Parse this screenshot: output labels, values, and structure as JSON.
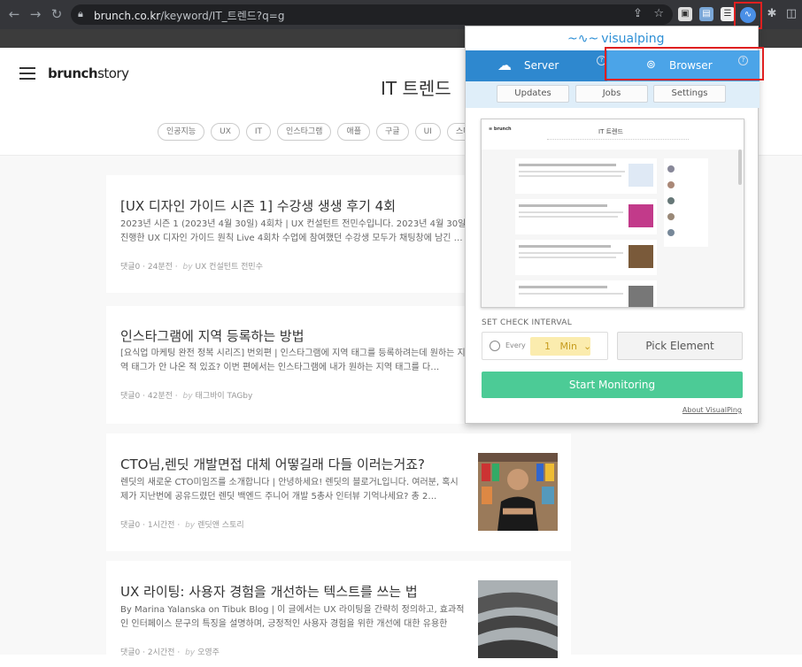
{
  "browser": {
    "url_host": "brunch.co.kr",
    "url_path": "/keyword/IT_트렌드?q=g"
  },
  "site": {
    "logo_main": "brunch",
    "logo_sub": "story",
    "page_title": "IT 트렌드",
    "tags": [
      "인공지능",
      "UX",
      "IT",
      "인스타그램",
      "애플",
      "구글",
      "UI",
      "스마트폰"
    ]
  },
  "articles": [
    {
      "title": "[UX 디자인 가이드 시즌 1] 수강생 생생 후기 4회",
      "desc": "2023년 시즌 1 (2023년 4월 30일) 4회차 | UX 컨설턴트 전민수입니다. 2023년 4월 30일 진행한 UX 디자인 가이드 원칙 Live 4회차 수업에 참여했던 수강생 모두가 채팅창에 남긴 …",
      "comments": "댓글0",
      "time": "24분전",
      "by": "by",
      "author": "UX 컨설턴트 전민수"
    },
    {
      "title": "인스타그램에 지역 등록하는 방법",
      "desc": "[요식업 마케팅 완전 정복 시리즈] 번외편 | 인스타그램에 지역 태그를 등록하려는데 원하는 지역 태그가 안 나온 적 있죠? 이번 편에서는 인스타그램에 내가 원하는 지역 태그를 다…",
      "comments": "댓글0",
      "time": "42분전",
      "by": "by",
      "author": "태그바이 TAGby"
    },
    {
      "title": "CTO님,렌딧 개발면접 대체 어떻길래 다들 이러는거죠?",
      "desc": "렌딧의 새로운 CTO미임즈를 소개합니다 | 안녕하세요! 렌딧의 블로거L입니다. 여러분, 혹시 제가 지난번에 공유드렸던 렌딧 백엔드 주니어 개발 5총사 인터뷰 기억나세요? 총 2…",
      "comments": "댓글0",
      "time": "1시간전",
      "by": "by",
      "author": "렌딧앤 스토리"
    },
    {
      "title": "UX 라이팅: 사용자 경험을 개선하는 텍스트를 쓰는 법",
      "desc": "By Marina Yalanska on Tibuk Blog | 이 글에서는 UX 라이팅을 간략히 정의하고, 효과적인 인터페이스 문구의 특징을 설명하며, 긍정적인 사용자 경험을 위한 개선에 대한 유용한 팁…",
      "comments": "댓글0",
      "time": "2시간전",
      "by": "by",
      "author": "오영주"
    }
  ],
  "visualping": {
    "brand": "visualping",
    "tab_server": "Server",
    "tab_browser": "Browser",
    "help": "?",
    "sub_updates": "Updates",
    "sub_jobs": "Jobs",
    "sub_settings": "Settings",
    "preview_title": "IT 트렌드",
    "interval_label": "SET CHECK INTERVAL",
    "every": "Every",
    "interval_value": "1",
    "interval_unit": "Min",
    "pick_element": "Pick Element",
    "start_monitoring": "Start Monitoring",
    "about": "About VisualPing"
  },
  "colors": {
    "vp_blue_dark": "#2e88cf",
    "vp_blue_light": "#4ba4e8",
    "vp_green": "#4ccb96",
    "highlight_red": "#e02020"
  }
}
